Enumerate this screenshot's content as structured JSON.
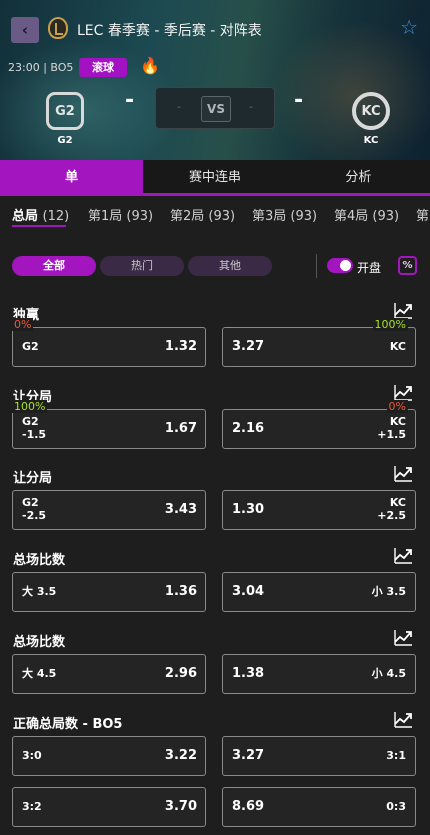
{
  "header": {
    "back_glyph": "‹",
    "title": "LEC 春季赛 - 季后赛 - 对阵表",
    "time": "23:00 | BO5",
    "live_label": "滚球",
    "home": {
      "name": "G2",
      "logo_text": "G2"
    },
    "away": {
      "name": "KC",
      "logo_text": "KC"
    },
    "score_left": "-",
    "score_right": "-",
    "vs": "VS",
    "dash": "-"
  },
  "mode_tabs": [
    "单",
    "赛中连串",
    "分析"
  ],
  "game_tabs": [
    {
      "label": "总局",
      "count": "(12)"
    },
    {
      "label": "第1局",
      "count": "(93)"
    },
    {
      "label": "第2局",
      "count": "(93)"
    },
    {
      "label": "第3局",
      "count": "(93)"
    },
    {
      "label": "第4局",
      "count": "(93)"
    },
    {
      "label": "第",
      "count": ""
    }
  ],
  "filters": {
    "chips": [
      "全部",
      "热门",
      "其他"
    ],
    "toggle_label": "开盘",
    "percent_glyph": "%",
    "toggle_on": true
  },
  "markets": [
    {
      "title": "独赢",
      "left": {
        "label": "G2",
        "label2": "",
        "odds": "1.32",
        "pct": "0%",
        "pct_color": "#e85a3a"
      },
      "right": {
        "label": "KC",
        "label2": "",
        "odds": "3.27",
        "pct": "100%",
        "pct_color": "#a6e22a"
      }
    },
    {
      "title": "让分局",
      "left": {
        "label": "G2",
        "label2": "-1.5",
        "odds": "1.67",
        "pct": "100%",
        "pct_color": "#a6e22a"
      },
      "right": {
        "label": "KC",
        "label2": "+1.5",
        "odds": "2.16",
        "pct": "0%",
        "pct_color": "#e85a3a"
      }
    },
    {
      "title": "让分局",
      "left": {
        "label": "G2",
        "label2": "-2.5",
        "odds": "3.43",
        "pct": "",
        "pct_color": ""
      },
      "right": {
        "label": "KC",
        "label2": "+2.5",
        "odds": "1.30",
        "pct": "",
        "pct_color": ""
      }
    },
    {
      "title": "总场比数",
      "left": {
        "label": "大 3.5",
        "label2": "",
        "odds": "1.36",
        "pct": "",
        "pct_color": ""
      },
      "right": {
        "label": "小 3.5",
        "label2": "",
        "odds": "3.04",
        "pct": "",
        "pct_color": ""
      }
    },
    {
      "title": "总场比数",
      "left": {
        "label": "大 4.5",
        "label2": "",
        "odds": "2.96",
        "pct": "",
        "pct_color": ""
      },
      "right": {
        "label": "小 4.5",
        "label2": "",
        "odds": "1.38",
        "pct": "",
        "pct_color": ""
      }
    },
    {
      "title": "正确总局数 - BO5",
      "left": {
        "label": "3:0",
        "label2": "",
        "odds": "3.22",
        "pct": "",
        "pct_color": ""
      },
      "right": {
        "label": "3:1",
        "label2": "",
        "odds": "3.27",
        "pct": "",
        "pct_color": ""
      }
    }
  ],
  "extra_row": {
    "left": {
      "label": "3:2",
      "odds": "3.70"
    },
    "right": {
      "label": "0:3",
      "odds": "8.69"
    }
  },
  "colors": {
    "accent": "#a315bf",
    "loss": "#e85a3a",
    "gain": "#a6e22a",
    "star": "#3d8bd6"
  }
}
